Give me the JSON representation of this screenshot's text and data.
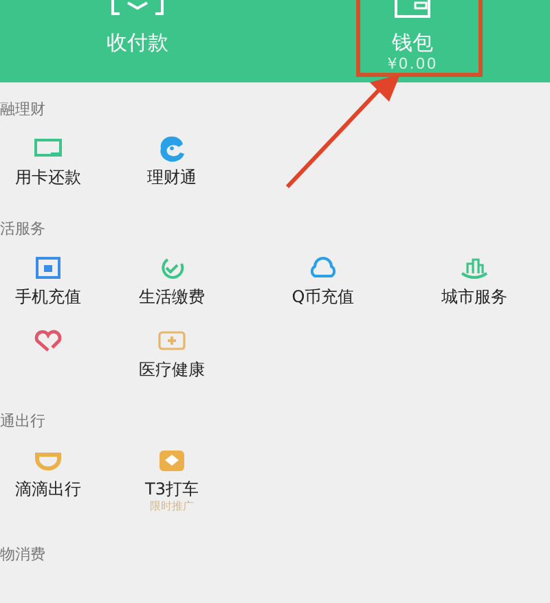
{
  "header": {
    "actions": [
      {
        "label": "收付款",
        "highlighted": false
      },
      {
        "label": "钱包",
        "balance": "¥0.00",
        "highlighted": true
      }
    ]
  },
  "sections": [
    {
      "title": "融理财",
      "items": [
        {
          "kind": "service",
          "label": "用卡还款"
        },
        {
          "kind": "service",
          "label": "理财通"
        }
      ]
    },
    {
      "title": "活服务",
      "items": [
        {
          "kind": "service",
          "label": "手机充值"
        },
        {
          "kind": "service",
          "label": "生活缴费"
        },
        {
          "kind": "service",
          "label": "Q币充值"
        },
        {
          "kind": "service",
          "label": "城市服务"
        },
        {
          "kind": "icon_only"
        },
        {
          "kind": "service",
          "label": "医疗健康"
        }
      ]
    },
    {
      "title": "通出行",
      "items": [
        {
          "kind": "service",
          "label": "滴滴出行"
        },
        {
          "kind": "service",
          "label": "T3打车",
          "note": "限时推广"
        }
      ]
    },
    {
      "title": "物消费"
    }
  ]
}
